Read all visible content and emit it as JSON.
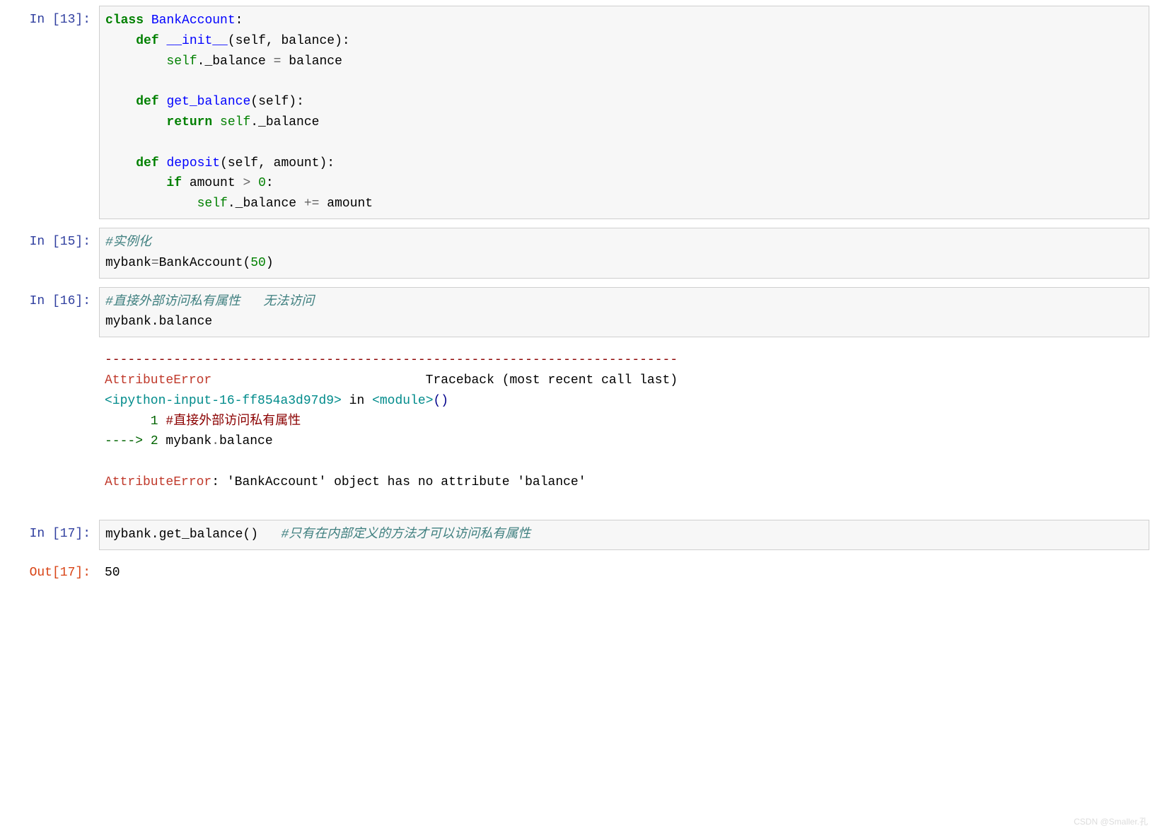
{
  "cells": [
    {
      "prompt_label": "In  [13]:",
      "code": {
        "l1_kw": "class",
        "l1_name": "BankAccount",
        "l1_colon": ":",
        "l2_indent": "    ",
        "l2_kw": "def",
        "l2_name": "__init__",
        "l2_args": "(self, balance):",
        "l3_indent": "        ",
        "l3_self": "self",
        "l3_rest": "._balance ",
        "l3_op": "=",
        "l3_end": " balance",
        "l4_blank": "",
        "l5_indent": "    ",
        "l5_kw": "def",
        "l5_name": "get_balance",
        "l5_args": "(self):",
        "l6_indent": "        ",
        "l6_kw": "return",
        "l6_self": " self",
        "l6_rest": "._balance",
        "l7_blank": "",
        "l8_indent": "    ",
        "l8_kw": "def",
        "l8_name": "deposit",
        "l8_args": "(self, amount):",
        "l9_indent": "        ",
        "l9_kw": "if",
        "l9_cond_a": " amount ",
        "l9_op": ">",
        "l9_cond_b": " ",
        "l9_zero": "0",
        "l9_colon": ":",
        "l10_indent": "            ",
        "l10_self": "self",
        "l10_rest": "._balance ",
        "l10_op": "+=",
        "l10_end": " amount"
      }
    },
    {
      "prompt_label": "In  [15]:",
      "code": {
        "l1_comment": "#实例化",
        "l2_a": "mybank",
        "l2_op": "=",
        "l2_b": "BankAccount(",
        "l2_num": "50",
        "l2_c": ")"
      }
    },
    {
      "prompt_label": "In  [16]:",
      "code": {
        "l1_comment": "#直接外部访问私有属性   无法访问",
        "l2": "mybank.balance"
      },
      "traceback": {
        "dash": "---------------------------------------------------------------------------",
        "exc_name": "AttributeError",
        "tb_label": "                            Traceback (most recent call last)",
        "ipyin": "<ipython-input-16-ff854a3d97d9>",
        "in_word": " in ",
        "module": "<module>",
        "parens": "()",
        "ln1_num": "      1 ",
        "ln1_txt": "#直接外部访问私有属性",
        "arrow": "----> ",
        "ln2_num": "2 ",
        "ln2_a": "mybank",
        "ln2_dot": ".",
        "ln2_b": "balance",
        "final_exc": "AttributeError",
        "final_msg": ": 'BankAccount' object has no attribute 'balance'"
      }
    },
    {
      "prompt_label": "In  [17]:",
      "code": {
        "l1_a": "mybank.get_balance()   ",
        "l1_comment": "#只有在内部定义的方法才可以访问私有属性"
      }
    },
    {
      "prompt_label": "Out[17]:",
      "output": "50"
    }
  ],
  "watermark": "CSDN @Smaller.孔"
}
